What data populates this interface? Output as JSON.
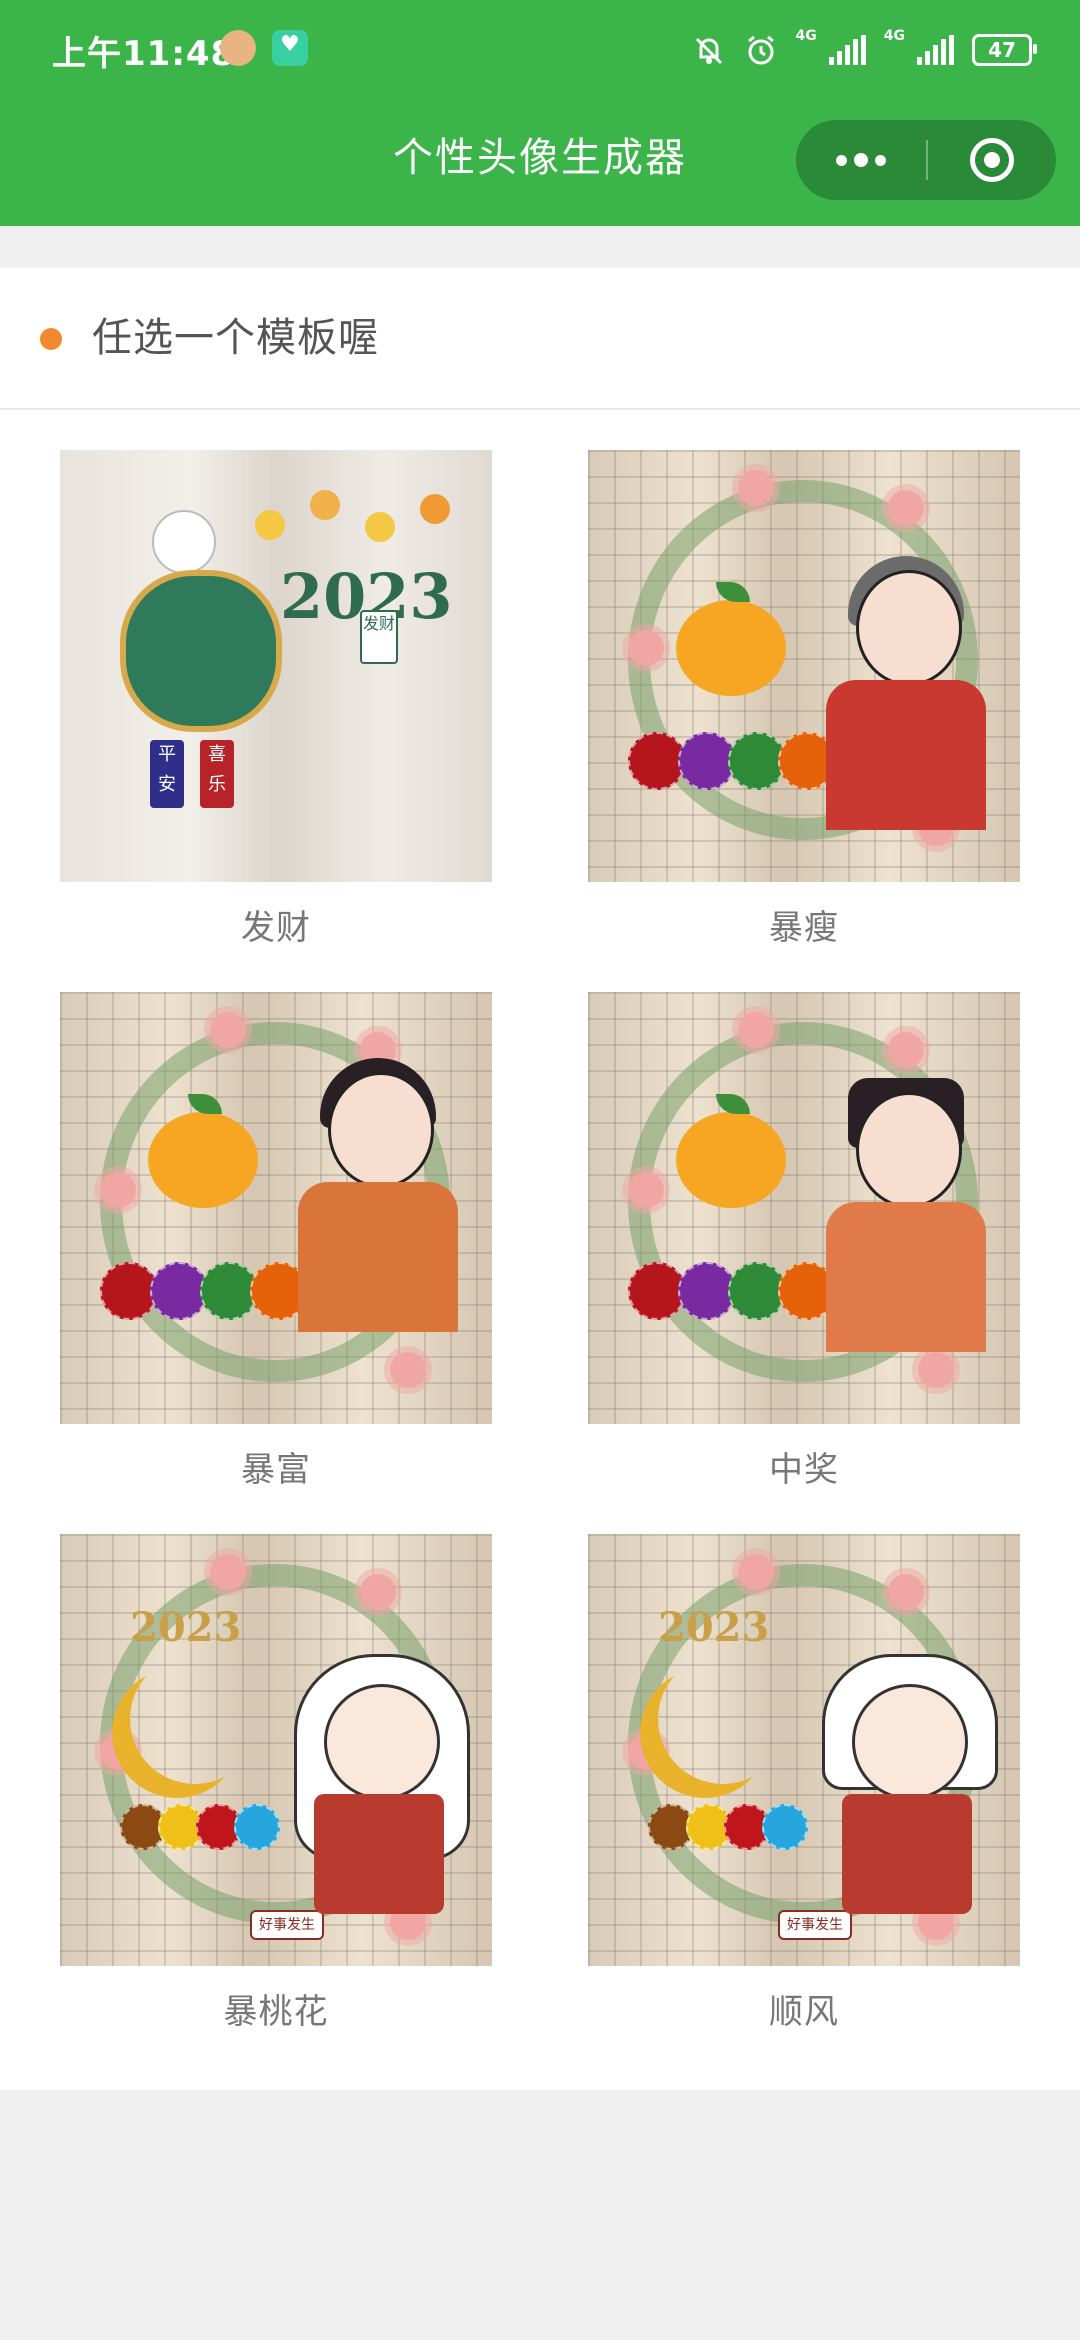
{
  "status_bar": {
    "time": "上午11:48",
    "network_1": "4G",
    "network_2": "4G",
    "battery": "47"
  },
  "nav": {
    "title": "个性头像生成器",
    "more_icon": "more-dots-icon",
    "close_icon": "target-close-icon"
  },
  "section": {
    "title": "任选一个模板喔",
    "accent": "#f28a2d"
  },
  "templates": [
    {
      "label": "发财"
    },
    {
      "label": "暴瘦"
    },
    {
      "label": "暴富"
    },
    {
      "label": "中奖"
    },
    {
      "label": "暴桃花"
    },
    {
      "label": "顺风"
    }
  ],
  "artwork": {
    "year": "2023",
    "tag_1": "平安",
    "tag_2": "喜乐",
    "tag_3": "发财",
    "badge": "好事发生"
  },
  "colors": {
    "brand_green": "#3bb54a",
    "capsule": "#2a8a37"
  }
}
